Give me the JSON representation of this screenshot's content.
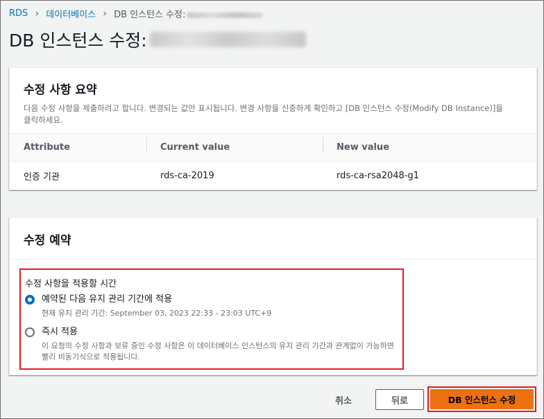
{
  "breadcrumb": {
    "items": [
      {
        "label": "RDS"
      },
      {
        "label": "데이터베이스"
      }
    ],
    "current": "DB 인스턴스 수정:"
  },
  "page": {
    "title": "DB 인스턴스 수정:"
  },
  "summary": {
    "title": "수정 사항 요약",
    "description": "다음 수정 사항을 제출하려고 합니다. 변경되는 값만 표시됩니다. 변경 사항을 신중하게 확인하고 [DB 인스턴스 수정(Modify DB Instance)]을 클릭하세요.",
    "columns": [
      "Attribute",
      "Current value",
      "New value"
    ],
    "rows": [
      [
        "인증 기관",
        "rds-ca-2019",
        "rds-ca-rsa2048-g1"
      ]
    ]
  },
  "schedule": {
    "title": "수정 예약",
    "group_label": "수정 사항을 적용할 시간",
    "options": [
      {
        "label": "예약된 다음 유지 관리 기간에 적용",
        "description": "현재 유지 관리 기간: September 03, 2023 22:33 - 23:03 UTC+9",
        "selected": true
      },
      {
        "label": "즉시 적용",
        "description": "이 요청의 수정 사항과 보류 중인 수정 사항은 이 데이터베이스 인스턴스의 유지 관리 기간과 관계없이 가능하면 빨리 비동기식으로 적용됩니다.",
        "selected": false
      }
    ]
  },
  "actions": {
    "cancel": "취소",
    "back": "뒤로",
    "submit": "DB 인스턴스 수정"
  },
  "colors": {
    "link": "#0073bb",
    "primary": "#ec7211",
    "highlight_border": "#e31b23",
    "background": "#f2f3f3"
  }
}
